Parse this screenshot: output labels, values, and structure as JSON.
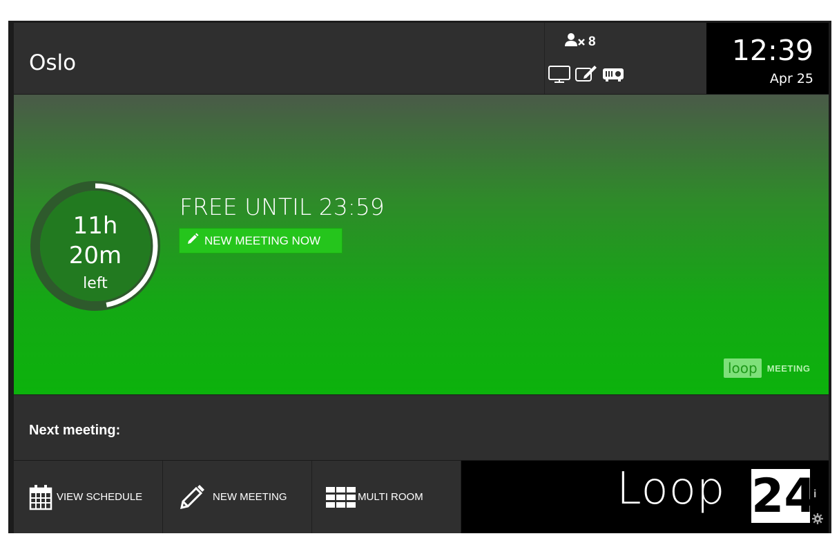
{
  "header": {
    "room_name": "Oslo",
    "capacity": "8",
    "equipment_icons": [
      "monitor-icon",
      "whiteboard-icon",
      "projector-icon"
    ],
    "clock_time": "12:39",
    "clock_date": "Apr 25"
  },
  "status": {
    "time_left_hours": "11h",
    "time_left_minutes": "20m",
    "time_left_suffix": "left",
    "time_left_fraction": 0.47,
    "title": "FREE UNTIL 23:59",
    "new_meeting_now_label": "NEW MEETING NOW",
    "logo_loop": "loop",
    "logo_meeting": "MEETING",
    "background_color": "#0cb20c"
  },
  "next": {
    "label": "Next meeting:"
  },
  "bottom": {
    "view_schedule_label": "VIEW SCHEDULE",
    "new_meeting_label": "NEW MEETING",
    "multi_room_label": "MULTI ROOM",
    "brand_loop": "Loop",
    "brand_24": "24"
  }
}
